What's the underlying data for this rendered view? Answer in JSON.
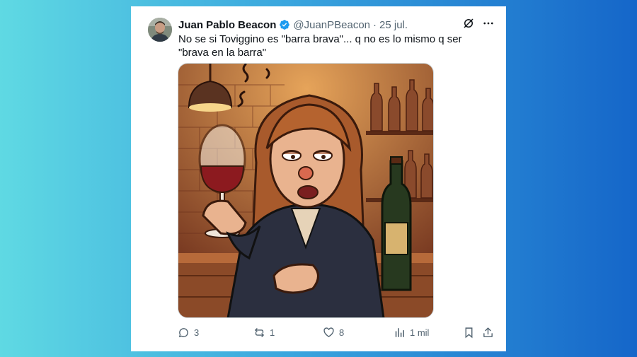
{
  "tweet": {
    "author_name": "Juan Pablo Beacon",
    "handle": "@JuanPBeacon",
    "separator": "·",
    "date": "25 jul.",
    "text": "No se si Toviggino es \"barra brava\"... q no es lo mismo q ser \"brava en la barra\"",
    "verified": true
  },
  "actions": {
    "replies": "3",
    "retweets": "1",
    "likes": "8",
    "views": "1 mil"
  },
  "icons": {
    "verified": "verified-badge-icon",
    "grok": "grok-icon",
    "more": "more-icon",
    "reply": "reply-icon",
    "retweet": "retweet-icon",
    "like": "like-icon",
    "views": "views-icon",
    "bookmark": "bookmark-icon",
    "share": "share-icon"
  },
  "colors": {
    "background_left": "#5fd9e3",
    "background_right": "#1566c9",
    "verified": "#1d9bf0",
    "muted": "#536471",
    "text": "#0f1419"
  }
}
